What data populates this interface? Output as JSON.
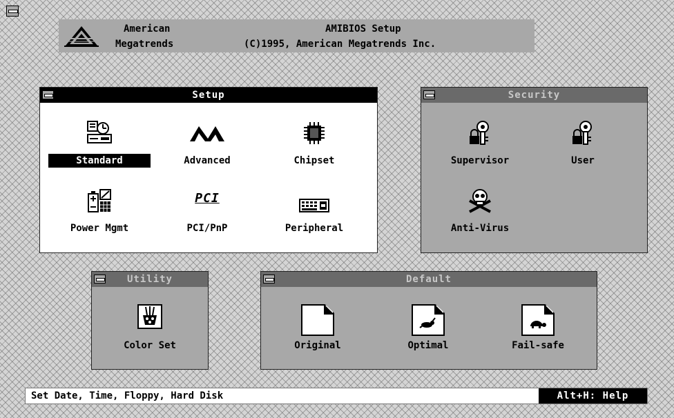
{
  "header": {
    "company_line1": "American",
    "company_line2": "Megatrends",
    "app_title": "AMIBIOS Setup",
    "copyright": "(C)1995, American Megatrends Inc."
  },
  "setup": {
    "title": "Setup",
    "items": [
      {
        "label": "Standard",
        "icon": "standard-icon",
        "selected": true
      },
      {
        "label": "Advanced",
        "icon": "advanced-icon"
      },
      {
        "label": "Chipset",
        "icon": "chipset-icon"
      },
      {
        "label": "Power Mgmt",
        "icon": "power-mgmt-icon"
      },
      {
        "label": "PCI/PnP",
        "icon": "pci-icon",
        "icon_text": "PCI"
      },
      {
        "label": "Peripheral",
        "icon": "peripheral-icon"
      }
    ]
  },
  "security": {
    "title": "Security",
    "items": [
      {
        "label": "Supervisor",
        "icon": "lock-key-icon"
      },
      {
        "label": "User",
        "icon": "lock-key-icon"
      },
      {
        "label": "Anti-Virus",
        "icon": "skull-crossbones-icon"
      }
    ]
  },
  "utility": {
    "title": "Utility",
    "items": [
      {
        "label": "Color Set",
        "icon": "palette-icon"
      }
    ]
  },
  "default": {
    "title": "Default",
    "items": [
      {
        "label": "Original",
        "icon": "document-icon"
      },
      {
        "label": "Optimal",
        "icon": "rabbit-document-icon"
      },
      {
        "label": "Fail-safe",
        "icon": "turtle-document-icon"
      }
    ]
  },
  "status": {
    "message": "Set Date, Time, Floppy, Hard Disk",
    "help": "Alt+H: Help"
  },
  "colors": {
    "desktop": "#d4d4d4",
    "window_inactive": "#a8a8a8",
    "titlebar_active": "#000000",
    "titlebar_inactive": "#6a6a6a"
  }
}
